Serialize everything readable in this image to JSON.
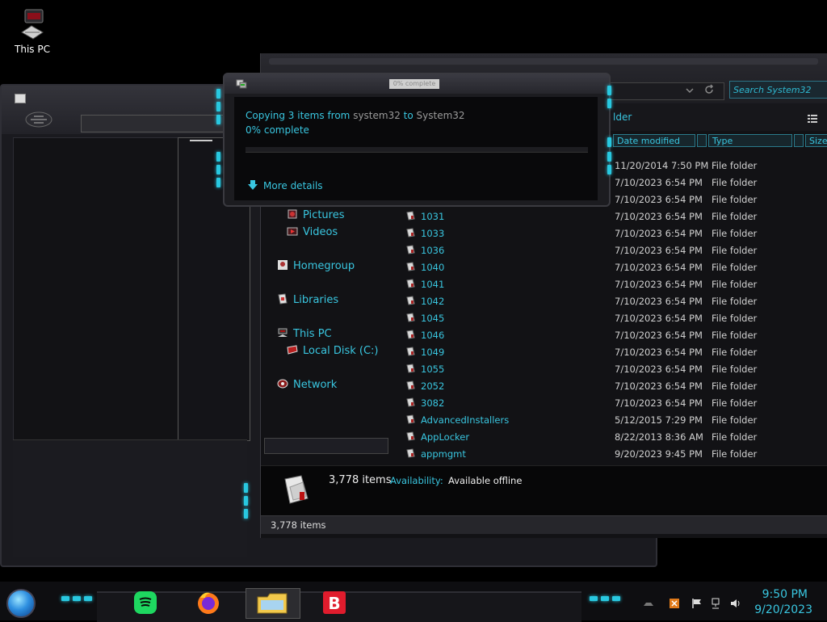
{
  "desktop": {
    "icon_label": "This PC"
  },
  "copy_dialog": {
    "title_obscured": "0% complete",
    "copying_prefix": "Copying 3 items from ",
    "source": "system32",
    "to_word": " to ",
    "destination": "System32",
    "percent": "0% complete",
    "progress_fraction": 0.0,
    "more_details": "More details"
  },
  "explorer": {
    "search_placeholder": "Search System32",
    "cmd_folder_label": "lder",
    "columns": {
      "date": "Date modified",
      "type": "Type",
      "size": "Size"
    },
    "nav": {
      "pictures": "Pictures",
      "videos": "Videos",
      "homegroup": "Homegroup",
      "libraries": "Libraries",
      "this_pc": "This PC",
      "local_disk": "Local Disk (C:)",
      "network": "Network"
    },
    "files": [
      {
        "name": "",
        "date": "11/20/2014 7:50 PM",
        "type": "File folder"
      },
      {
        "name": "",
        "date": "7/10/2023 6:54 PM",
        "type": "File folder"
      },
      {
        "name": "",
        "date": "7/10/2023 6:54 PM",
        "type": "File folder"
      },
      {
        "name": "1031",
        "date": "7/10/2023 6:54 PM",
        "type": "File folder"
      },
      {
        "name": "1033",
        "date": "7/10/2023 6:54 PM",
        "type": "File folder"
      },
      {
        "name": "1036",
        "date": "7/10/2023 6:54 PM",
        "type": "File folder"
      },
      {
        "name": "1040",
        "date": "7/10/2023 6:54 PM",
        "type": "File folder"
      },
      {
        "name": "1041",
        "date": "7/10/2023 6:54 PM",
        "type": "File folder"
      },
      {
        "name": "1042",
        "date": "7/10/2023 6:54 PM",
        "type": "File folder"
      },
      {
        "name": "1045",
        "date": "7/10/2023 6:54 PM",
        "type": "File folder"
      },
      {
        "name": "1046",
        "date": "7/10/2023 6:54 PM",
        "type": "File folder"
      },
      {
        "name": "1049",
        "date": "7/10/2023 6:54 PM",
        "type": "File folder"
      },
      {
        "name": "1055",
        "date": "7/10/2023 6:54 PM",
        "type": "File folder"
      },
      {
        "name": "2052",
        "date": "7/10/2023 6:54 PM",
        "type": "File folder"
      },
      {
        "name": "3082",
        "date": "7/10/2023 6:54 PM",
        "type": "File folder"
      },
      {
        "name": "AdvancedInstallers",
        "date": "5/12/2015 7:29 PM",
        "type": "File folder"
      },
      {
        "name": "AppLocker",
        "date": "8/22/2013 8:36 AM",
        "type": "File folder"
      },
      {
        "name": "appmgmt",
        "date": "9/20/2023 9:45 PM",
        "type": "File folder"
      }
    ],
    "details": {
      "count": "3,778 items",
      "availability_label": "Availability:",
      "availability_value": "Available offline"
    },
    "status": "3,778 items"
  },
  "taskbar": {
    "time": "9:50 PM",
    "date": "9/20/2023",
    "apps": [
      "spotify-icon",
      "firefox-icon",
      "file-explorer-icon",
      "bitdefender-icon"
    ],
    "accent": "#39c6e0"
  }
}
